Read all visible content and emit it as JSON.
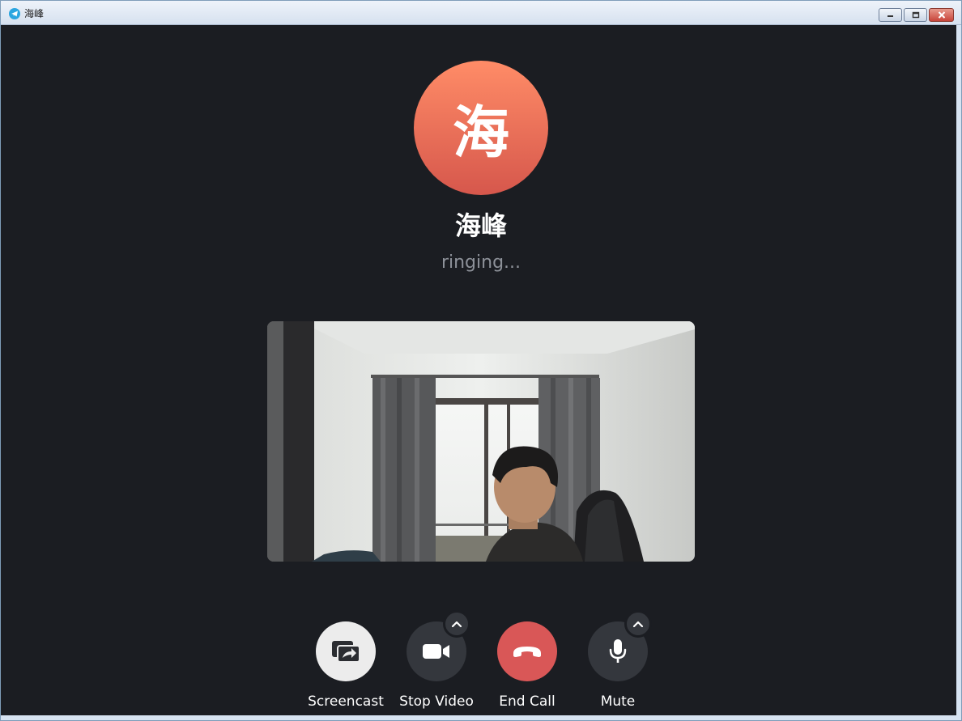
{
  "window": {
    "title": "海峰",
    "icon": "telegram-icon",
    "controls": [
      "minimize-icon",
      "maximize-icon",
      "close-icon"
    ]
  },
  "call": {
    "avatar_initial": "海",
    "avatar_gradient": [
      "#ff8c67",
      "#d6574c"
    ],
    "contact_name": "海峰",
    "status": "ringing..."
  },
  "self_video": {
    "content": "camera-preview"
  },
  "controls": {
    "screencast": {
      "label": "Screencast",
      "icon": "screencast-icon"
    },
    "video": {
      "label": "Stop Video",
      "icon": "camera-icon",
      "has_options": true
    },
    "end_call": {
      "label": "End Call",
      "icon": "phone-hangup-icon",
      "color": "#d95757"
    },
    "mute": {
      "label": "Mute",
      "icon": "microphone-icon",
      "has_options": true
    }
  },
  "colors": {
    "background": "#1b1d22",
    "button_dark": "#34373d",
    "button_light": "#ececec",
    "status_text": "#8d9199"
  }
}
